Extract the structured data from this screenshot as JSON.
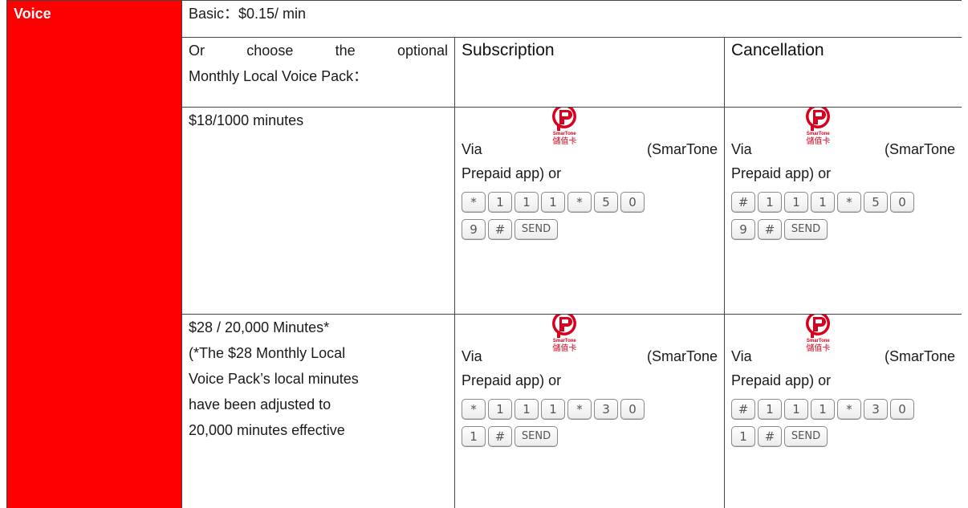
{
  "voice_label": "Voice",
  "basic_rate": "Basic：$0.15/ min",
  "optional_pack": {
    "line1": "Or choose the optional",
    "line2": "Monthly Local Voice Pack："
  },
  "headers": {
    "subscription": "Subscription",
    "cancellation": "Cancellation"
  },
  "app": {
    "via": "Via",
    "name": "(SmarTone",
    "suffix": "Prepaid app) or",
    "icon_caption": "SmarTone",
    "icon_chinese": "儲值卡",
    "icon": "smartone-prepaid-app-icon",
    "brand_color": "#d8001c"
  },
  "plans": [
    {
      "name_lines": [
        "$18/1000 minutes"
      ],
      "subscribe_keys_row1": [
        "*",
        "1",
        "1",
        "1",
        "*",
        "5",
        "0"
      ],
      "subscribe_keys_row2": [
        "9",
        "#",
        "SEND"
      ],
      "cancel_keys_row1": [
        "#",
        "1",
        "1",
        "1",
        "*",
        "5",
        "0"
      ],
      "cancel_keys_row2": [
        "9",
        "#",
        "SEND"
      ]
    },
    {
      "name_lines": [
        "$28 / 20,000 Minutes*",
        "(*The $28 Monthly Local",
        "Voice Pack’s local minutes",
        "have been adjusted to",
        "20,000 minutes effective"
      ],
      "subscribe_keys_row1": [
        "*",
        "1",
        "1",
        "1",
        "*",
        "3",
        "0"
      ],
      "subscribe_keys_row2": [
        "1",
        "#",
        "SEND"
      ],
      "cancel_keys_row1": [
        "#",
        "1",
        "1",
        "1",
        "*",
        "3",
        "0"
      ],
      "cancel_keys_row2": [
        "1",
        "#",
        "SEND"
      ]
    }
  ],
  "colors": {
    "voice_bg": "#ff0000",
    "voice_text": "#ffffff",
    "border": "#444444"
  }
}
